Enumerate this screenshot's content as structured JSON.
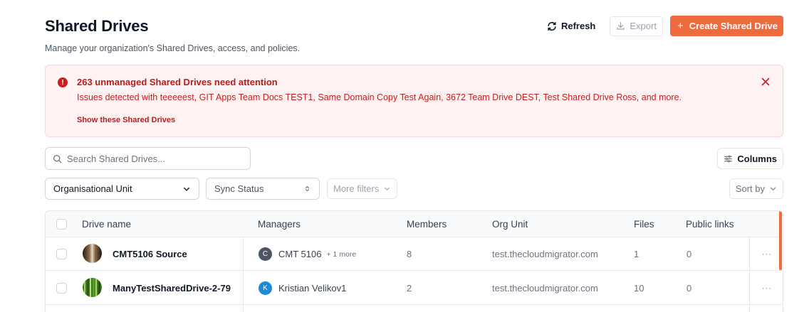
{
  "header": {
    "title": "Shared Drives",
    "subtitle": "Manage your organization's Shared Drives, access, and policies.",
    "refresh_label": "Refresh",
    "export_label": "Export",
    "create_label": "Create Shared Drive",
    "create_icon": "+"
  },
  "alert": {
    "title": "263 unmanaged Shared Drives need attention",
    "body": "Issues detected with teeeeest, GIT Apps Team Docs TEST1, Same Domain Copy Test Again, 3672 Team Drive DEST, Test Shared Drive Ross, and more.",
    "link": "Show these Shared Drives",
    "icon_glyph": "!"
  },
  "toolbar": {
    "search_placeholder": "Search Shared Drives...",
    "columns_label": "Columns",
    "org_unit_label": "Organisational Unit",
    "sync_status_label": "Sync Status",
    "more_filters_label": "More filters",
    "sort_label": "Sort by"
  },
  "table": {
    "headers": {
      "drive_name": "Drive name",
      "managers": "Managers",
      "members": "Members",
      "org_unit": "Org Unit",
      "files": "Files",
      "public_links": "Public links"
    },
    "rows": [
      {
        "name": "CMT5106 Source",
        "manager_initial": "C",
        "manager_name": "CMT 5106",
        "manager_more": "+ 1 more",
        "members": "8",
        "org_unit": "test.thecloudmigrator.com",
        "files": "1",
        "public_links": "0",
        "menu": "···"
      },
      {
        "name": "ManyTestSharedDrive-2-79",
        "manager_initial": "K",
        "manager_name": "Kristian Velikov1",
        "manager_more": "",
        "members": "2",
        "org_unit": "test.thecloudmigrator.com",
        "files": "10",
        "public_links": "0",
        "menu": "···"
      }
    ]
  },
  "colors": {
    "accent": "#ef6a3c",
    "alert_bg": "#fef2f2",
    "alert_text": "#c81e1e",
    "avatar_c": "#4b5563",
    "avatar_k": "#1d8ad6"
  },
  "icons": {
    "refresh": "refresh-icon",
    "export": "download-icon",
    "alert": "alert-circle-icon",
    "close": "close-icon",
    "search": "search-icon",
    "columns": "sliders-icon",
    "chevron": "chevron-down-icon",
    "updown": "chevron-up-down-icon"
  }
}
